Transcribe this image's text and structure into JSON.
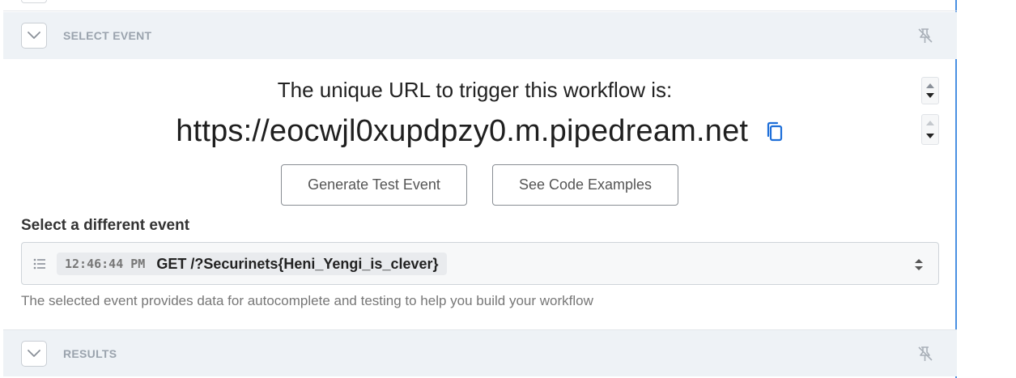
{
  "sections": {
    "select_event": {
      "title": "SELECT EVENT"
    },
    "results": {
      "title": "RESULTS"
    }
  },
  "trigger": {
    "label": "The unique URL to trigger this workflow is:",
    "url": "https://eocwjl0xupdpzy0.m.pipedream.net"
  },
  "buttons": {
    "generate": "Generate Test Event",
    "code_examples": "See Code Examples"
  },
  "event_picker": {
    "label": "Select a different event",
    "selected_time": "12:46:44 PM",
    "selected_request": "GET /?Securinets{Heni_Yengi_is_clever}",
    "helper": "The selected event provides data for autocomplete and testing to help you build your workflow"
  },
  "icons": {
    "toggle": "chevron-down-icon",
    "pin": "unpin-icon",
    "copy": "copy-icon",
    "list": "list-icon",
    "sort": "sort-icon"
  },
  "colors": {
    "accent": "#4a90e2",
    "copy_icon": "#1e6fd9",
    "section_bg": "#eef2f6",
    "section_title": "#9aa3ad"
  }
}
